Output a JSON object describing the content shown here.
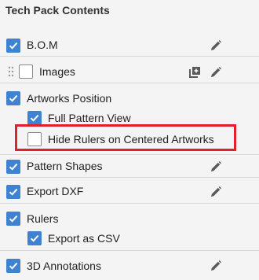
{
  "panel": {
    "title": "Tech Pack Contents"
  },
  "items": [
    {
      "label": "B.O.M",
      "checked": true,
      "icons": [
        "pencil-icon"
      ]
    },
    {
      "label": "Images",
      "checked": false,
      "icons": [
        "drag-handle-icon",
        "add-image-icon",
        "pencil-icon"
      ]
    },
    {
      "label": "Artworks Position",
      "checked": true,
      "icons": []
    },
    {
      "label": "Full Pattern View",
      "checked": true,
      "icons": []
    },
    {
      "label": "Hide Rulers on Centered Artworks",
      "checked": false,
      "icons": []
    },
    {
      "label": "Pattern Shapes",
      "checked": true,
      "icons": [
        "pencil-icon"
      ]
    },
    {
      "label": "Export DXF",
      "checked": true,
      "icons": [
        "pencil-icon"
      ]
    },
    {
      "label": "Rulers",
      "checked": true,
      "icons": []
    },
    {
      "label": "Export as CSV",
      "checked": true,
      "icons": []
    },
    {
      "label": "3D Annotations",
      "checked": true,
      "icons": [
        "pencil-icon"
      ]
    }
  ],
  "colors": {
    "checkbox_checked": "#3f82d1",
    "highlight_border": "#e0202a",
    "background": "#f4f4f4"
  }
}
